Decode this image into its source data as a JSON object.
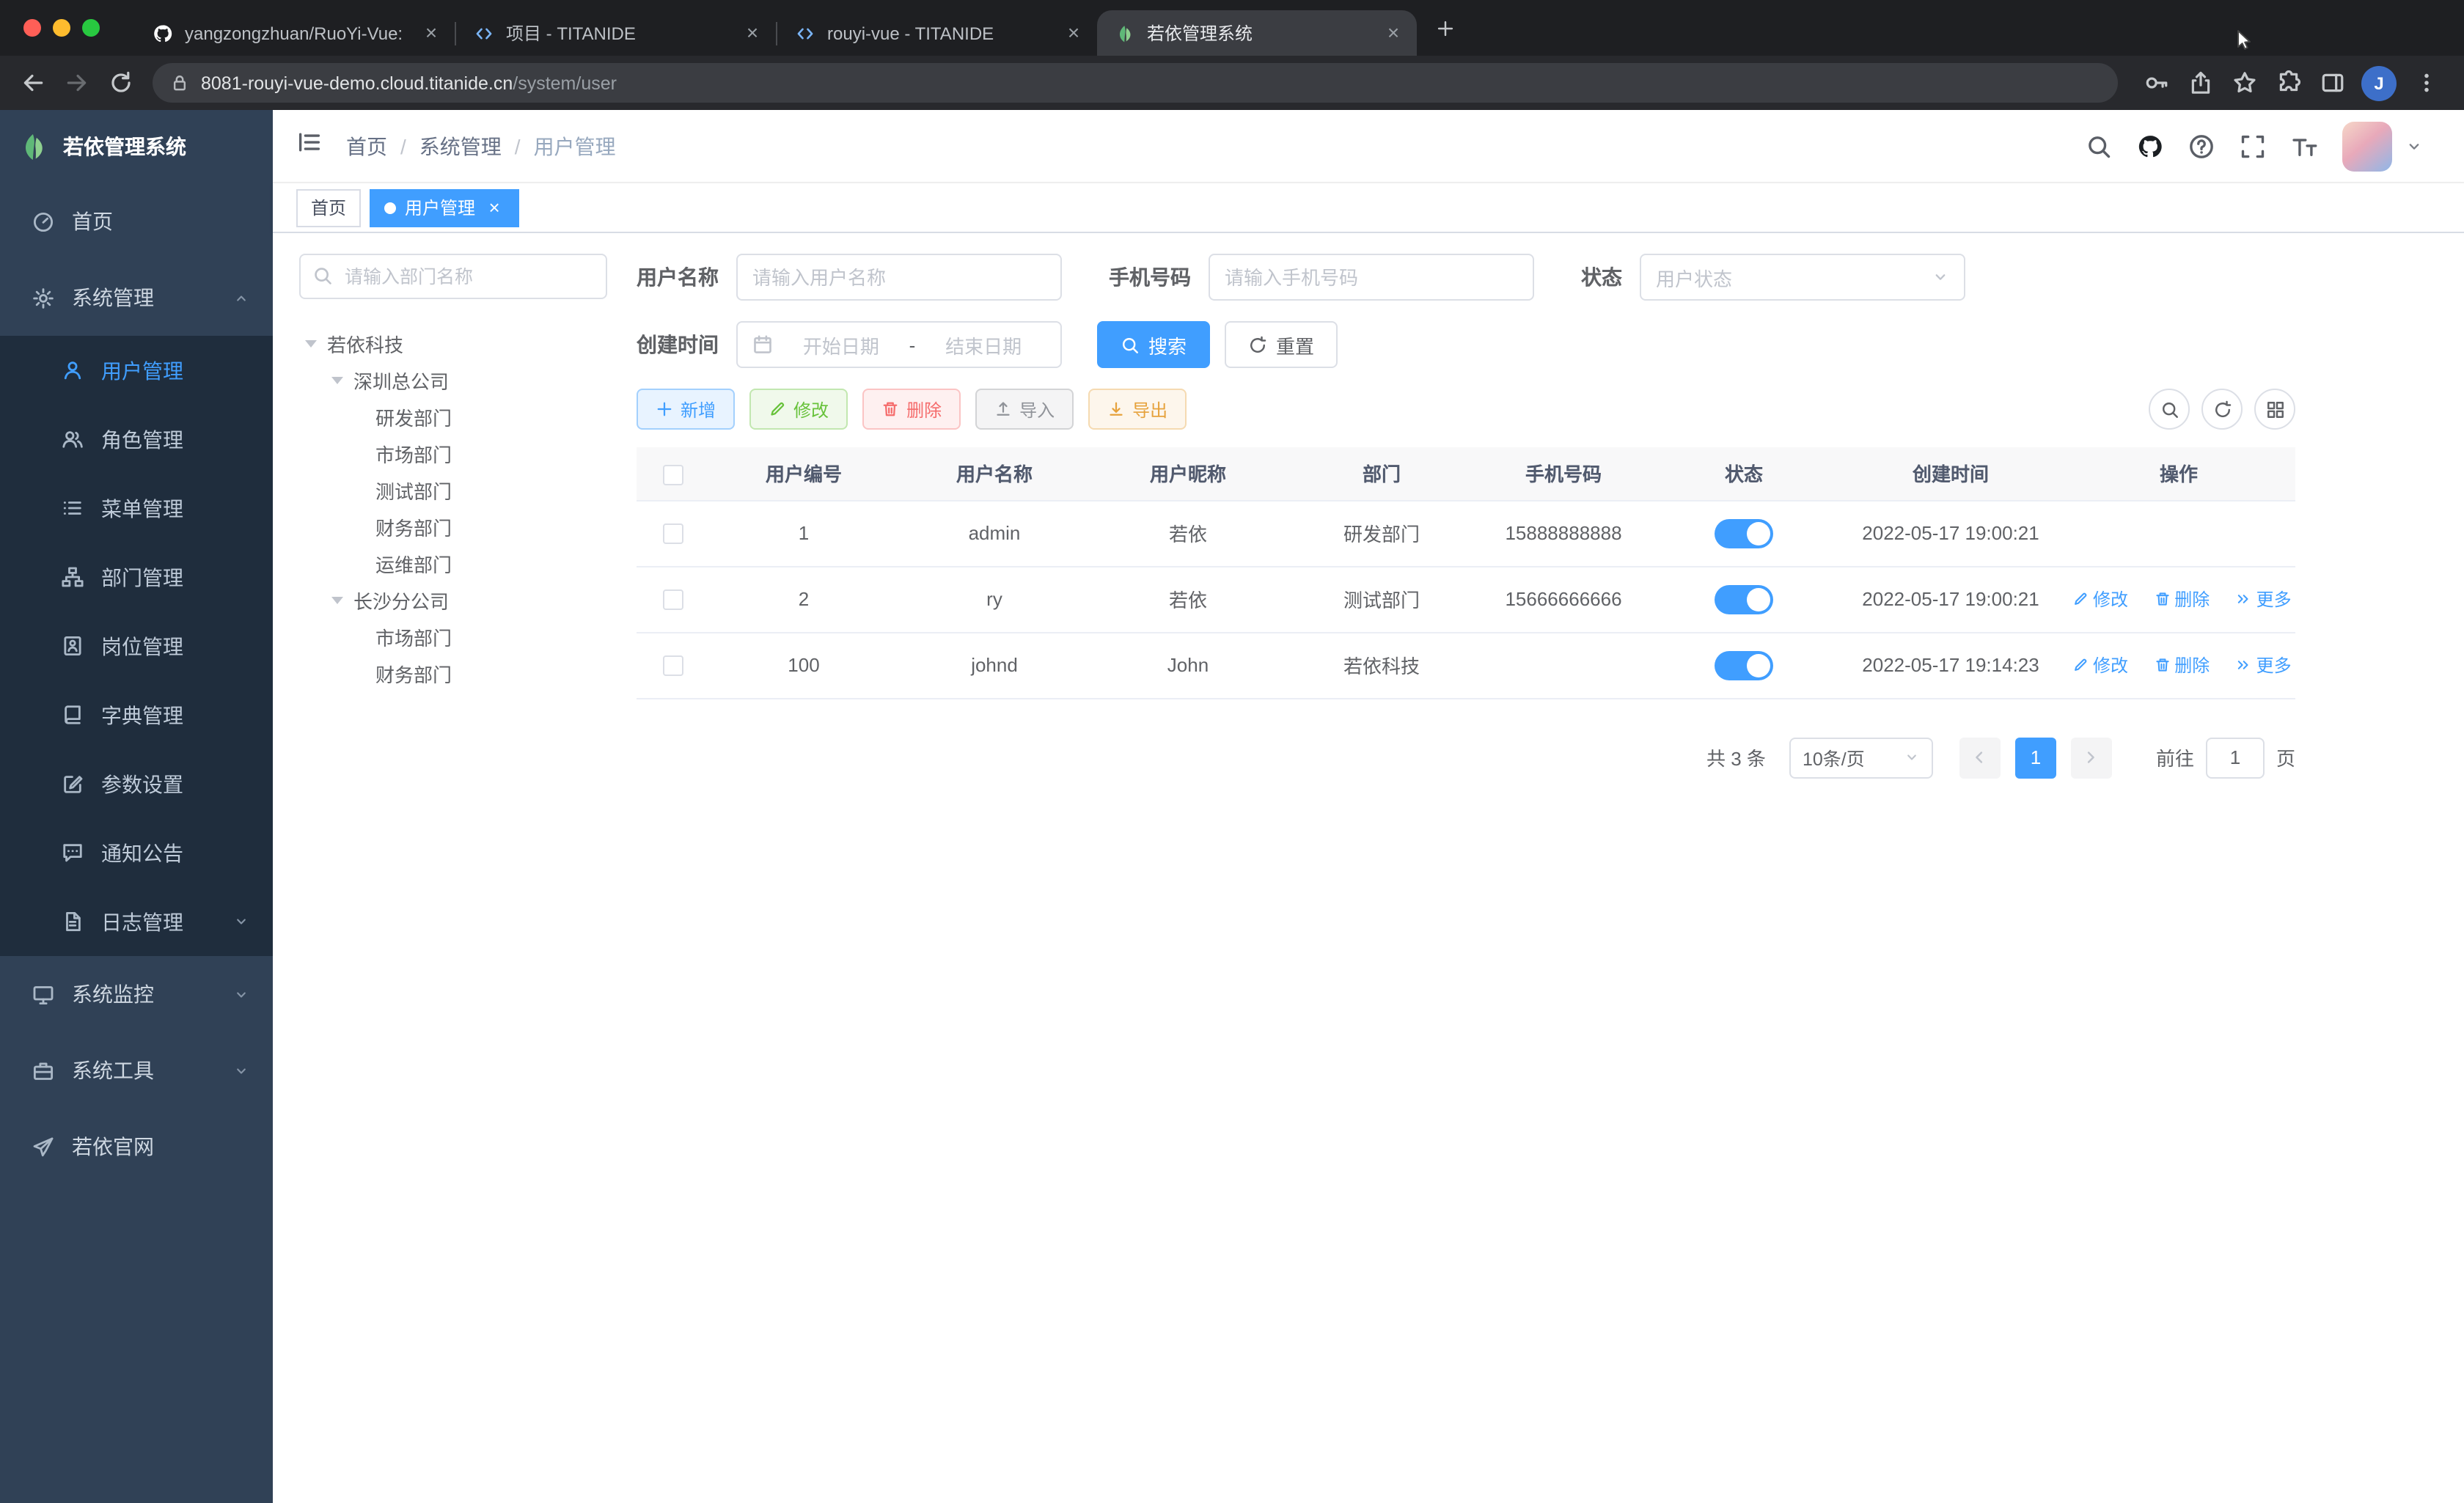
{
  "icons": {
    "close": "×"
  },
  "colors": {
    "primary": "#409eff",
    "success": "#67c23a",
    "warning": "#e6a23c",
    "danger": "#f56c6c",
    "info": "#909399",
    "sidebar_bg": "#304156",
    "submenu_bg": "#1f2d3d",
    "toggle_on": "#409eff"
  },
  "browser": {
    "tabs": [
      {
        "title": "yangzongzhuan/RuoYi-Vue: (R"
      },
      {
        "title": "项目 - TITANIDE"
      },
      {
        "title": "rouyi-vue - TITANIDE"
      },
      {
        "title": "若依管理系统"
      }
    ],
    "url_host": "8081-rouyi-vue-demo.cloud.titanide.cn",
    "url_path": "/system/user",
    "profile_initial": "J"
  },
  "app": {
    "logo_title": "若依管理系统",
    "menu": {
      "home": "首页",
      "system": "系统管理",
      "system_children": [
        "用户管理",
        "角色管理",
        "菜单管理",
        "部门管理",
        "岗位管理",
        "字典管理",
        "参数设置",
        "通知公告",
        "日志管理"
      ],
      "monitor": "系统监控",
      "tools": "系统工具",
      "site": "若依官网"
    },
    "breadcrumb": [
      "首页",
      "系统管理",
      "用户管理"
    ],
    "breadcrumb_sep": "/",
    "tags": [
      {
        "label": "首页"
      },
      {
        "label": "用户管理"
      }
    ]
  },
  "dept": {
    "search_placeholder": "请输入部门名称",
    "tree": [
      {
        "label": "若依科技",
        "level": 0
      },
      {
        "label": "深圳总公司",
        "level": 1
      },
      {
        "label": "研发部门",
        "level": 2
      },
      {
        "label": "市场部门",
        "level": 2
      },
      {
        "label": "测试部门",
        "level": 2
      },
      {
        "label": "财务部门",
        "level": 2
      },
      {
        "label": "运维部门",
        "level": 2
      },
      {
        "label": "长沙分公司",
        "level": 1
      },
      {
        "label": "市场部门",
        "level": 2
      },
      {
        "label": "财务部门",
        "level": 2
      }
    ]
  },
  "filter": {
    "username_label": "用户名称",
    "username_placeholder": "请输入用户名称",
    "phone_label": "手机号码",
    "phone_placeholder": "请输入手机号码",
    "status_label": "状态",
    "status_placeholder": "用户状态",
    "created_label": "创建时间",
    "date_start": "开始日期",
    "date_sep": "-",
    "date_end": "结束日期",
    "search": "搜索",
    "reset": "重置"
  },
  "toolbar": {
    "add": "新增",
    "edit": "修改",
    "delete": "删除",
    "import": "导入",
    "export": "导出"
  },
  "table": {
    "headers": [
      "用户编号",
      "用户名称",
      "用户昵称",
      "部门",
      "手机号码",
      "状态",
      "创建时间",
      "操作"
    ],
    "rows": [
      {
        "id": "1",
        "username": "admin",
        "nickname": "若依",
        "dept": "研发部门",
        "phone": "15888888888",
        "status": "on",
        "created": "2022-05-17 19:00:21"
      },
      {
        "id": "2",
        "username": "ry",
        "nickname": "若依",
        "dept": "测试部门",
        "phone": "15666666666",
        "status": "on",
        "created": "2022-05-17 19:00:21"
      },
      {
        "id": "100",
        "username": "johnd",
        "nickname": "John",
        "dept": "若依科技",
        "phone": "",
        "status": "on",
        "created": "2022-05-17 19:14:23"
      }
    ],
    "row_actions": {
      "edit": "修改",
      "delete": "删除",
      "more": "更多"
    }
  },
  "pagination": {
    "total": "共 3 条",
    "page_size": "10条/页",
    "page": "1",
    "goto": "前往",
    "goto_value": "1",
    "unit": "页"
  }
}
